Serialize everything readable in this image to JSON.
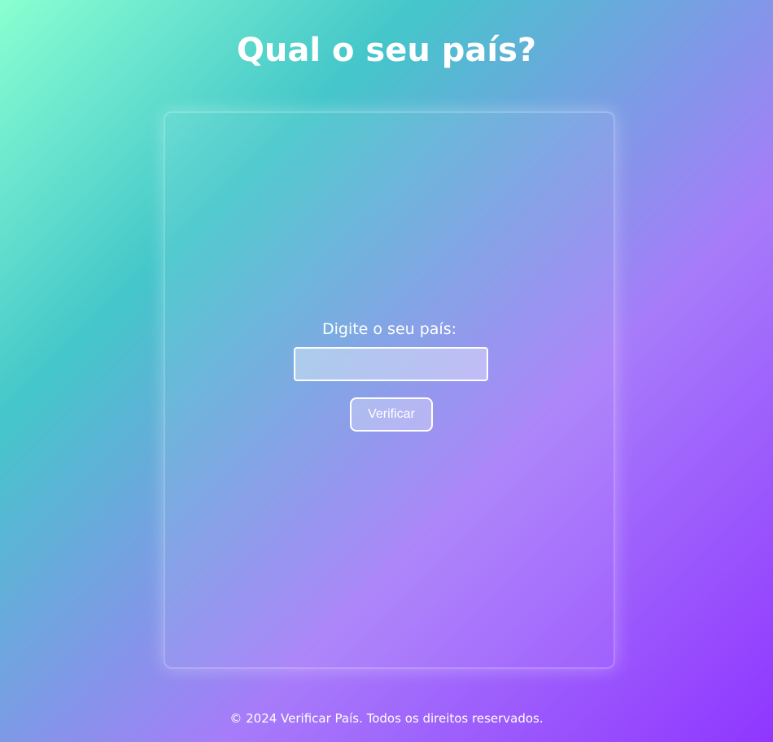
{
  "header": {
    "title": "Qual o seu país?"
  },
  "form": {
    "label": "Digite o seu país:",
    "input_value": "",
    "input_placeholder": "",
    "button_label": "Verificar"
  },
  "footer": {
    "text": "© 2024 Verificar País. Todos os direitos reservados."
  },
  "colors": {
    "gradient_start": "#8affd1",
    "gradient_mid": "#44c6ca",
    "gradient_mid2": "#a77bfa",
    "gradient_end": "#8f36ff",
    "text": "#ffffff"
  }
}
